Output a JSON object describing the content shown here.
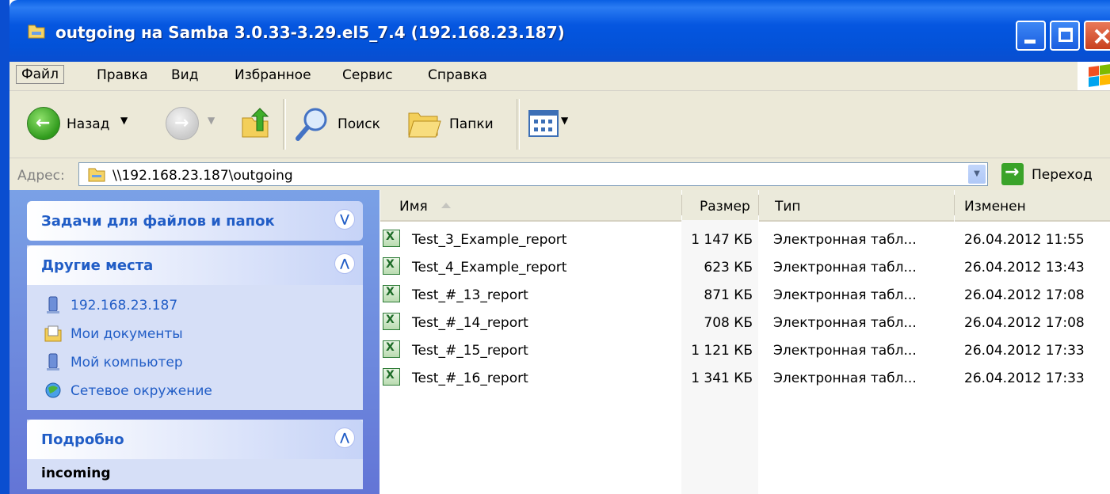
{
  "window": {
    "title": "outgoing на Samba 3.0.33-3.29.el5_7.4 (192.168.23.187)",
    "icon": "network-folder-icon"
  },
  "menu": {
    "items": [
      "Файл",
      "Правка",
      "Вид",
      "Избранное",
      "Сервис",
      "Справка"
    ]
  },
  "toolbar": {
    "back_label": "Назад",
    "search_label": "Поиск",
    "folders_label": "Папки"
  },
  "address": {
    "label": "Адрес:",
    "path": "\\\\192.168.23.187\\outgoing",
    "go_label": "Переход"
  },
  "sidebar": {
    "tasks_title": "Задачи для файлов и папок",
    "places_title": "Другие места",
    "places": [
      {
        "label": "192.168.23.187",
        "icon": "network-computer-icon"
      },
      {
        "label": "Мои документы",
        "icon": "my-documents-icon"
      },
      {
        "label": "Мой компьютер",
        "icon": "my-computer-icon"
      },
      {
        "label": "Сетевое окружение",
        "icon": "network-places-icon"
      }
    ],
    "details_title": "Подробно",
    "details_value": "incoming"
  },
  "files": {
    "columns": [
      "Имя",
      "Размер",
      "Тип",
      "Изменен"
    ],
    "rows": [
      {
        "name": "Test_3_Example_report",
        "size": "1 147 КБ",
        "type": "Электронная табл...",
        "modified": "26.04.2012 11:55"
      },
      {
        "name": "Test_4_Example_report",
        "size": "623 КБ",
        "type": "Электронная табл...",
        "modified": "26.04.2012 13:43"
      },
      {
        "name": "Test_#_13_report",
        "size": "871 КБ",
        "type": "Электронная табл...",
        "modified": "26.04.2012 17:08"
      },
      {
        "name": "Test_#_14_report",
        "size": "708 КБ",
        "type": "Электронная табл...",
        "modified": "26.04.2012 17:08"
      },
      {
        "name": "Test_#_15_report",
        "size": "1 121 КБ",
        "type": "Электронная табл...",
        "modified": "26.04.2012 17:33"
      },
      {
        "name": "Test_#_16_report",
        "size": "1 341 КБ",
        "type": "Электронная табл...",
        "modified": "26.04.2012 17:33"
      }
    ]
  }
}
